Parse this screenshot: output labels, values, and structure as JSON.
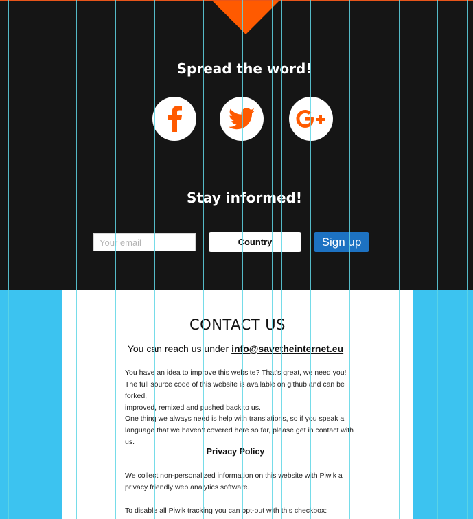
{
  "share": {
    "heading": "Spread the word!",
    "facebook_icon": "facebook-icon",
    "twitter_icon": "twitter-icon",
    "googleplus_icon": "google-plus-icon"
  },
  "newsletter": {
    "heading": "Stay informed!",
    "email_placeholder": "Your email",
    "country_label": "Country",
    "signup_label": "Sign up"
  },
  "contact": {
    "title": "CONTACT US",
    "reach_prefix": "You can reach us under",
    "email": "info@savetheinternet.eu",
    "para1_line1": " You have an idea to improve this website? That's great, we need you!",
    "para1_line2": "The full source code of this website is available on github and can be forked,",
    "para1_line3": "improved, remixed and pushed back to us.",
    "para2_line1": "One thing we always need is help with translations, so if you speak a",
    "para2_line2": "language that we haven't covered here so far, please get in contact with us.",
    "privacy_title": "Privacy Policy",
    "para3_line1": "We collect non-personalized information on this website with Piwik a",
    "para3_line2": "privacy friendly web analytics software.",
    "para4_line1": "To disable all Piwik tracking you can opt-out with this checkbox:"
  },
  "colors": {
    "dark_bg": "#151515",
    "accent_orange": "#ff5a00",
    "signup_blue": "#1d72c2",
    "side_blue": "#3cc3f0"
  }
}
